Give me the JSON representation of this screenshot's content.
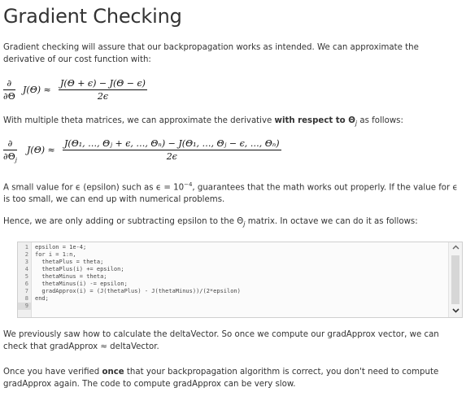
{
  "title": "Gradient Checking",
  "intro": "Gradient checking will assure that our backpropagation works as intended. We can approximate the derivative of our cost function with:",
  "eq1": {
    "lhs_num": "∂",
    "lhs_den": "∂Θ",
    "func": "J(Θ) ≈",
    "num": "J(Θ + ϵ) − J(Θ − ϵ)",
    "den": "2ϵ"
  },
  "multi_text_a": "With multiple theta matrices, we can approximate the derivative ",
  "multi_text_b": "with respect to Θ",
  "multi_text_sub": "j",
  "multi_text_c": " as follows:",
  "eq2": {
    "lhs_num": "∂",
    "lhs_den": "∂Θ",
    "lhs_den_sub": "j",
    "func": "J(Θ) ≈",
    "num": "J(Θ₁, …, Θⱼ + ϵ, …, Θₙ) − J(Θ₁, …, Θⱼ − ϵ, …, Θₙ)",
    "den": "2ϵ"
  },
  "epsilon_text_a": "A small value for ϵ (epsilon) such as ϵ = 10",
  "epsilon_exp": "−4",
  "epsilon_text_b": ", guarantees that the math works out properly. If the value for ϵ is too small, we can end up with numerical problems.",
  "hence_text_a": "Hence, we are only adding or subtracting epsilon to the Θ",
  "hence_sub": "j",
  "hence_text_b": " matrix. In octave we can do it as follows:",
  "code": {
    "line_numbers": [
      "1",
      "2",
      "3",
      "4",
      "5",
      "6",
      "7",
      "8",
      "9"
    ],
    "lines": [
      "epsilon = 1e-4;",
      "for i = 1:n,",
      "  thetaPlus = theta;",
      "  thetaPlus(i) += epsilon;",
      "  thetaMinus = theta;",
      "  thetaMinus(i) -= epsilon;",
      "  gradApprox(i) = (J(thetaPlus) - J(thetaMinus))/(2*epsilon)",
      "end;",
      ""
    ]
  },
  "delta_text": "We previously saw how to calculate the deltaVector. So once we compute our gradApprox vector, we can check that gradApprox ≈ deltaVector.",
  "once_text_a": "Once you have verified ",
  "once_text_b": "once",
  "once_text_c": " that your backpropagation algorithm is correct, you don't need to compute gradApprox again. The code to compute gradApprox can be very slow."
}
